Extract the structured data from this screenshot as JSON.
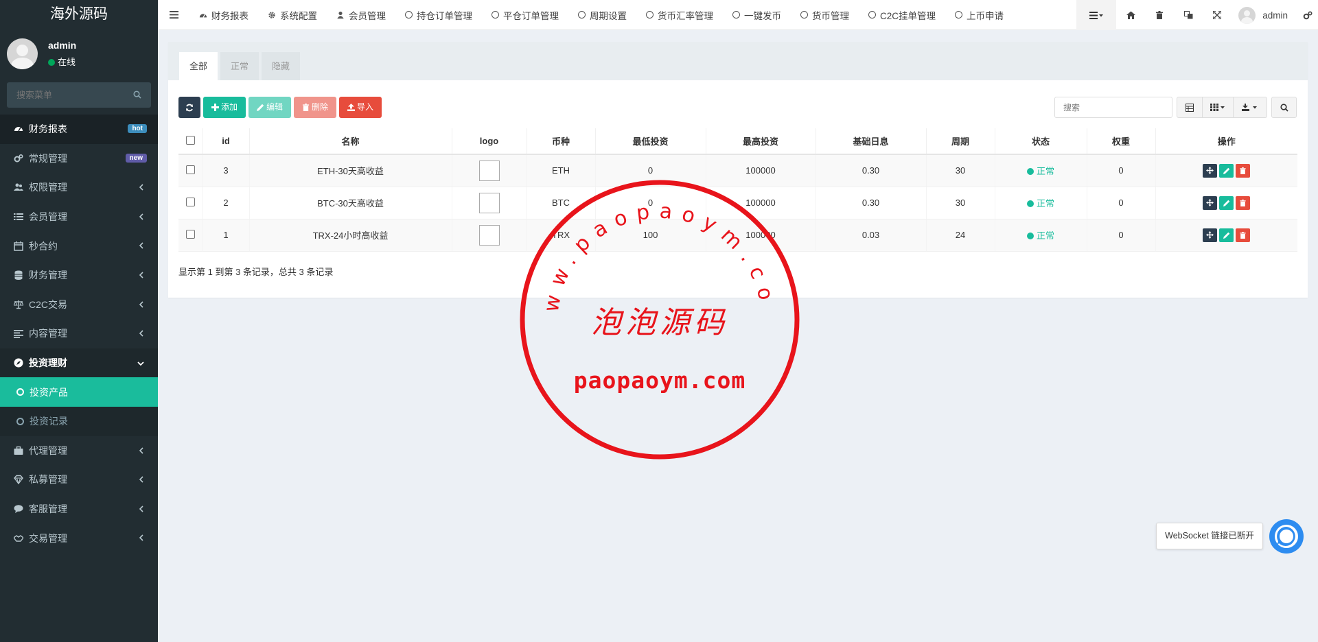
{
  "app": {
    "logo_text": "海外源码"
  },
  "user": {
    "name": "admin",
    "status": "在线"
  },
  "sidebar": {
    "search_placeholder": "搜索菜单",
    "items": [
      {
        "label": "财务报表",
        "badge": "hot",
        "badge_color": "#3c8dbc"
      },
      {
        "label": "常规管理",
        "badge": "new",
        "badge_color": "#605ca8"
      },
      {
        "label": "权限管理"
      },
      {
        "label": "会员管理"
      },
      {
        "label": "秒合约"
      },
      {
        "label": "财务管理"
      },
      {
        "label": "C2C交易"
      },
      {
        "label": "内容管理"
      },
      {
        "label": "投资理财"
      },
      {
        "label": "投资产品"
      },
      {
        "label": "投资记录"
      },
      {
        "label": "代理管理"
      },
      {
        "label": "私募管理"
      },
      {
        "label": "客服管理"
      },
      {
        "label": "交易管理"
      }
    ]
  },
  "topnav": {
    "items": [
      {
        "label": "财务报表",
        "icon": "dashboard-icon"
      },
      {
        "label": "系统配置",
        "icon": "gear-icon"
      },
      {
        "label": "会员管理",
        "icon": "user-icon"
      },
      {
        "label": "持仓订单管理",
        "icon": "circle-icon"
      },
      {
        "label": "平仓订单管理",
        "icon": "circle-icon"
      },
      {
        "label": "周期设置",
        "icon": "circle-icon"
      },
      {
        "label": "货币汇率管理",
        "icon": "circle-icon"
      },
      {
        "label": "一键发币",
        "icon": "circle-icon"
      },
      {
        "label": "货币管理",
        "icon": "circle-icon"
      },
      {
        "label": "C2C挂单管理",
        "icon": "circle-icon"
      },
      {
        "label": "上币申请",
        "icon": "circle-icon"
      }
    ],
    "admin_name": "admin"
  },
  "tabs": [
    "全部",
    "正常",
    "隐藏"
  ],
  "toolbar": {
    "add_label": "添加",
    "edit_label": "编辑",
    "delete_label": "删除",
    "import_label": "导入",
    "search_placeholder": "搜索"
  },
  "table": {
    "headers": [
      "id",
      "名称",
      "logo",
      "币种",
      "最低投资",
      "最高投资",
      "基础日息",
      "周期",
      "状态",
      "权重",
      "操作"
    ],
    "rows": [
      {
        "id": "3",
        "name": "ETH-30天高收益",
        "coin": "ETH",
        "min": "0",
        "max": "100000",
        "rate": "0.30",
        "period": "30",
        "status": "正常",
        "weight": "0"
      },
      {
        "id": "2",
        "name": "BTC-30天高收益",
        "coin": "BTC",
        "min": "0",
        "max": "100000",
        "rate": "0.30",
        "period": "30",
        "status": "正常",
        "weight": "0"
      },
      {
        "id": "1",
        "name": "TRX-24小时高收益",
        "coin": "TRX",
        "min": "100",
        "max": "100000",
        "rate": "0.03",
        "period": "24",
        "status": "正常",
        "weight": "0"
      }
    ],
    "footer": "显示第 1 到第 3 条记录，总共 3 条记录"
  },
  "stamp": {
    "arc_text": "www.paopaoym.com",
    "center_text": "泡泡源码",
    "bottom_text": "paopaoym.com",
    "color": "#e8141b"
  },
  "websocket": {
    "message": "WebSocket 链接已断开"
  }
}
